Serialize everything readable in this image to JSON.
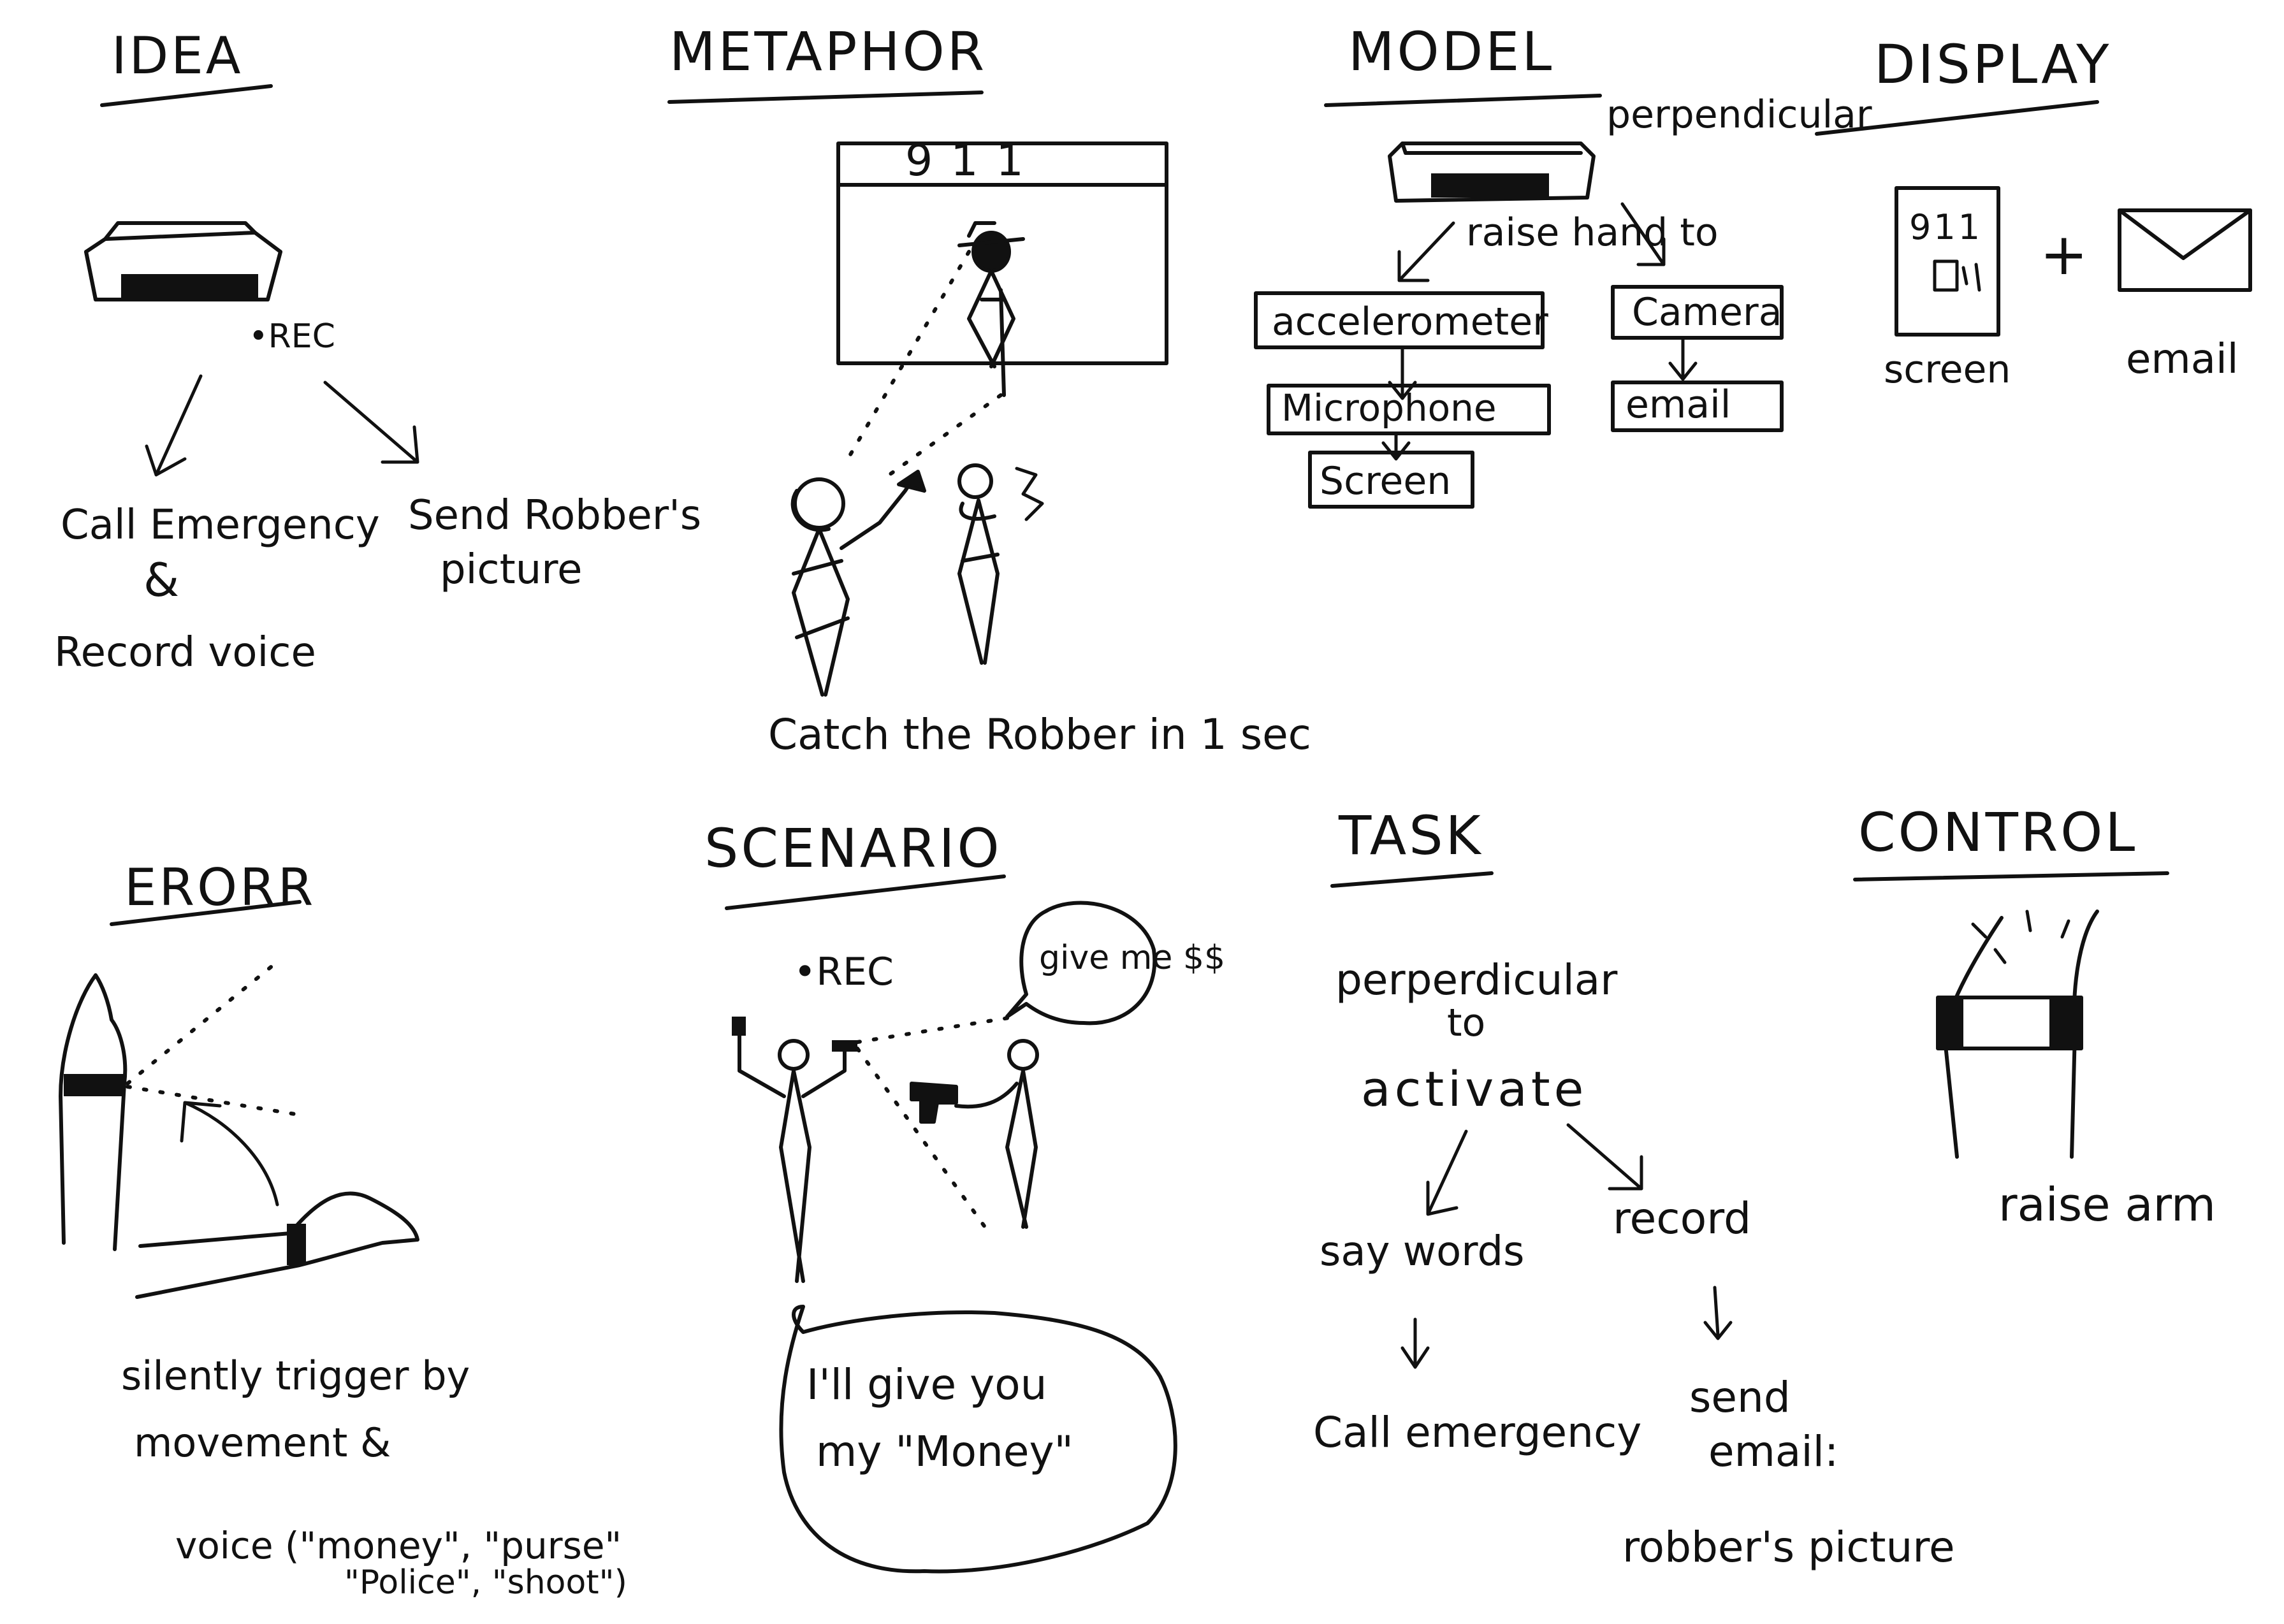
{
  "idea": {
    "heading": "IDEA",
    "rec": "•REC",
    "call_line1": "Call Emergency",
    "call_line2": "&",
    "call_line3": "Record voice",
    "send_line1": "Send Robber's",
    "send_line2": "picture"
  },
  "metaphor": {
    "heading": "METAPHOR",
    "screen_number": "911",
    "caption": "Catch the Robber in 1 sec"
  },
  "model": {
    "heading": "MODEL",
    "perpendicular": "perpendicular",
    "raise_hand": "raise hand to",
    "accelerometer": "accelerometer",
    "microphone": "Microphone",
    "screen": "Screen",
    "camera": "Camera",
    "email": "email"
  },
  "display": {
    "heading": "DISPLAY",
    "screen_number": "911",
    "screen_caption": "screen",
    "plus": "+",
    "email_caption": "email"
  },
  "error": {
    "heading": "ERORR",
    "line1": "silently trigger by",
    "line2": "movement &",
    "line3": "voice (\"money\", \"purse\"",
    "line4": "\"Police\", \"shoot\")"
  },
  "scenario": {
    "heading": "SCENARIO",
    "rec": "•REC",
    "bubble_robber": "give me $$",
    "bubble_victim_line1": "I'll give you",
    "bubble_victim_line2": "my \"Money\""
  },
  "task": {
    "heading": "TASK",
    "line1": "perperdicular",
    "line2": "to",
    "line3": "activate",
    "say_words": "say words",
    "record": "record",
    "call_emergency": "Call emergency",
    "send_line1": "send",
    "send_line2": "email:",
    "send_line3": "robber's picture"
  },
  "control": {
    "heading": "CONTROL",
    "caption": "raise arm"
  }
}
